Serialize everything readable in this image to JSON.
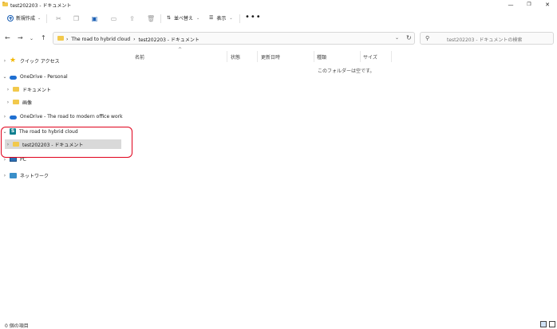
{
  "window": {
    "title": "test202203 - ドキュメント",
    "minimize_glyph": "—",
    "maximize_glyph": "❐",
    "close_glyph": "✕"
  },
  "toolbar": {
    "new_label": "新規作成",
    "sort_label": "並べ替え",
    "view_label": "表示",
    "more_label": "•••",
    "icons": [
      "cut-icon",
      "copy-icon",
      "paste-icon",
      "rename-icon",
      "share-icon",
      "delete-icon"
    ]
  },
  "address": {
    "crumbs": [
      "The road to hybrid cloud",
      "test202203 - ドキュメント"
    ],
    "separator": "›"
  },
  "search": {
    "placeholder": "test202203 - ドキュメントの検索"
  },
  "sidebar": {
    "items": [
      {
        "label": "クイック アクセス",
        "icon": "star-icon",
        "expand": "›"
      },
      {
        "label": "OneDrive - Personal",
        "icon": "cloud-icon",
        "expand": "⌄"
      },
      {
        "label": "ドキュメント",
        "icon": "folder-icon",
        "expand": "›"
      },
      {
        "label": "画像",
        "icon": "folder-icon",
        "expand": "›"
      },
      {
        "label": "OneDrive - The road to modern office work",
        "icon": "cloud-icon",
        "expand": "›"
      },
      {
        "label": "The road to hybrid cloud",
        "icon": "sharepoint-icon",
        "expand": "⌄"
      },
      {
        "label": "test202203 - ドキュメント",
        "icon": "folder-icon",
        "expand": "›"
      },
      {
        "label": "PC",
        "icon": "pc-icon",
        "expand": "›"
      },
      {
        "label": "ネットワーク",
        "icon": "network-icon",
        "expand": "›"
      }
    ]
  },
  "content": {
    "columns": [
      "名前",
      "状態",
      "更新日時",
      "種類",
      "サイズ"
    ],
    "sort_indicator": "^",
    "empty_message": "このフォルダーは空です。"
  },
  "status": {
    "item_count": "0 個の項目"
  },
  "colors": {
    "accent": "#1a5fb4",
    "highlight_border": "#e0001b",
    "selection": "#d9d9d9",
    "folder": "#f2c94c"
  }
}
